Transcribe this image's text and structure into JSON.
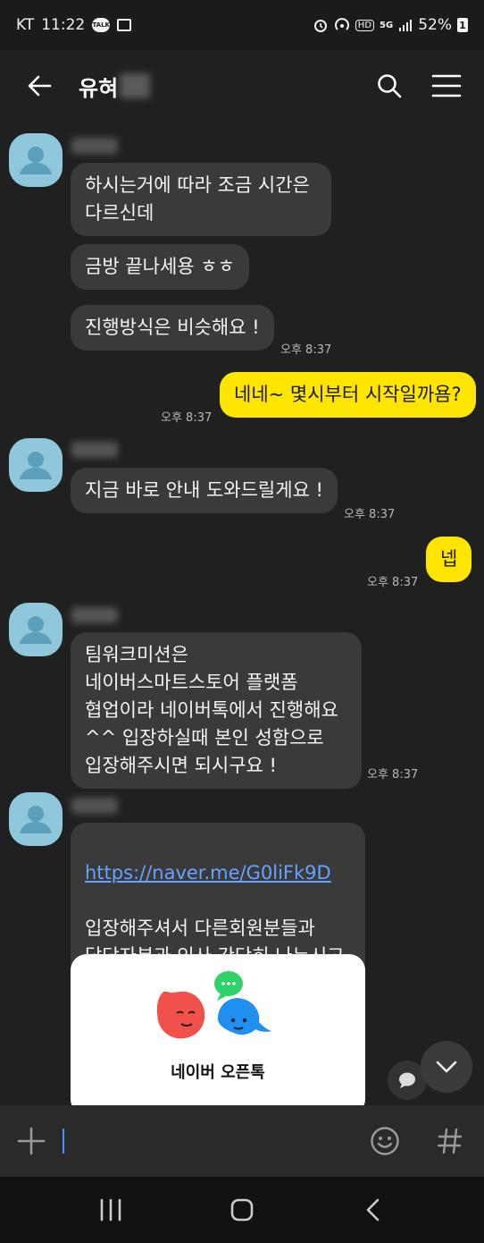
{
  "status_bar": {
    "carrier": "KT",
    "time": "11:22",
    "talk_badge": "TALK",
    "hd": "HD",
    "network": "5G",
    "battery": "52%",
    "battery_badge": "1"
  },
  "header": {
    "title": "유혀"
  },
  "messages": [
    {
      "id": "m1",
      "text": "하시는거에 따라 조금 시간은\n다르신데"
    },
    {
      "id": "m2",
      "text": "금방 끝나세용 ㅎㅎ"
    },
    {
      "id": "m3",
      "text": "진행방식은 비슷해요 !",
      "time": "오후 8:37"
    },
    {
      "id": "m4",
      "text": "네네~ 몇시부터 시작일까욤?",
      "time": "오후 8:37",
      "mine": true
    },
    {
      "id": "m5",
      "text": "지금 바로 안내 도와드릴게요 !",
      "time": "오후 8:37"
    },
    {
      "id": "m6",
      "text": "넵",
      "time": "오후 8:37",
      "mine": true
    },
    {
      "id": "m7",
      "text": "팀워크미션은\n네이버스마트스토어 플랫폼\n협업이라 네이버톡에서 진행해요\n^^ 입장하실때 본인 성함으로\n입장해주시면 되시구요 !",
      "time": "오후 8:37"
    },
    {
      "id": "m8",
      "link": "https://naver.me/G0liFk9D",
      "text": "입장해주셔서 다른회원분들과\n담당자분과 인사 간단히 나누시고\n진행하시면 되세요 ^^"
    }
  ],
  "card": {
    "title": "네이버 오픈톡"
  },
  "colors": {
    "background": "#202020",
    "bubble_other": "#3a3a3a",
    "bubble_me": "#fee500",
    "avatar": "#8fc8dc",
    "link": "#66a3ff"
  },
  "icons": [
    "back-arrow-icon",
    "search-icon",
    "menu-icon",
    "plus-icon",
    "emoji-icon",
    "hashtag-icon",
    "chevron-down-icon",
    "chat-bubble-icon",
    "recents-icon",
    "home-icon",
    "back-nav-icon"
  ]
}
